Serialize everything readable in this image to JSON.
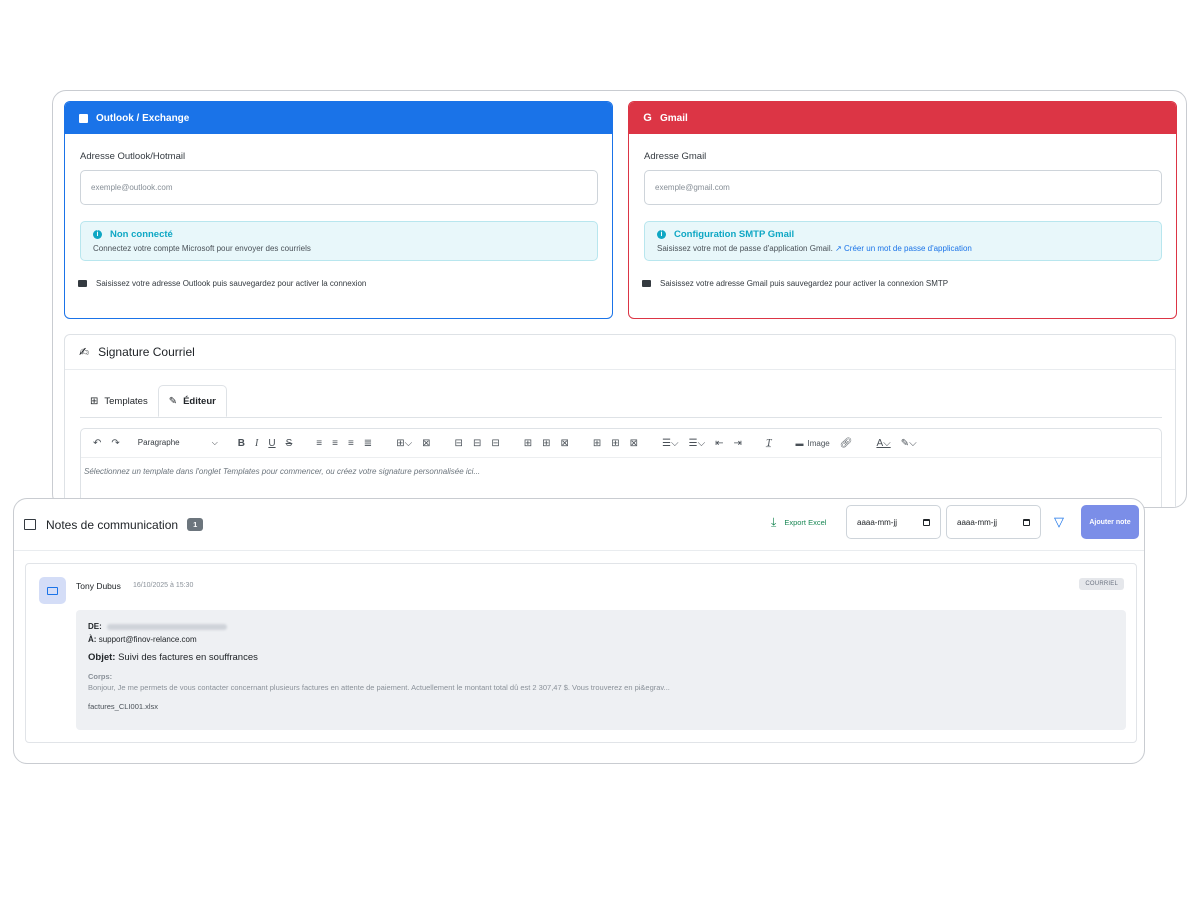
{
  "outlook": {
    "header": "Outlook / Exchange",
    "field_label": "Adresse Outlook/Hotmail",
    "placeholder": "exemple@outlook.com",
    "alert_title": "Non connecté",
    "alert_text": "Connectez votre compte Microsoft pour envoyer des courriels",
    "note": "Saisissez votre adresse Outlook puis sauvegardez pour activer la connexion"
  },
  "gmail": {
    "header": "Gmail",
    "field_label": "Adresse Gmail",
    "placeholder": "exemple@gmail.com",
    "alert_title": "Configuration SMTP Gmail",
    "alert_text": "Saisissez votre mot de passe d'application Gmail.",
    "alert_link": "Créer un mot de passe d'application",
    "note": "Saisissez votre adresse Gmail puis sauvegardez pour activer la connexion SMTP"
  },
  "signature": {
    "title": "Signature Courriel",
    "tabs": [
      {
        "label": "Templates"
      },
      {
        "label": "Éditeur"
      }
    ],
    "paragraph_select": "Paragraphe",
    "image_label": "Image",
    "placeholder": "Sélectionnez un template dans l'onglet Templates pour commencer, ou créez votre signature personnalisée ici..."
  },
  "notes": {
    "title": "Notes de communication",
    "count": "1",
    "export_label": "Export Excel",
    "date_from_placeholder": "aaaa-mm-jj",
    "date_to_placeholder": "aaaa-mm-jj",
    "add_label": "Ajouter note",
    "items": [
      {
        "author": "Tony Dubus",
        "date": "16/10/2025 à 15:30",
        "type": "COURRIEL",
        "from_label": "DE:",
        "to_label": "À:",
        "to": "support@finov-relance.com",
        "subject_label": "Objet:",
        "subject": "Suivi des factures en souffrances",
        "body_label": "Corps:",
        "body": "Bonjour, Je me permets de vous contacter concernant plusieurs factures en attente de paiement. Actuellement le montant total dû est 2 307,47 $. Vous trouverez en pi&egrav...",
        "attachment": "factures_CLI001.xlsx"
      }
    ]
  },
  "colors": {
    "outlook": "#1a73e8",
    "gmail": "#dc3545",
    "info": "#0fa7c4",
    "export": "#198754",
    "add_button": "#7b8ee8"
  }
}
